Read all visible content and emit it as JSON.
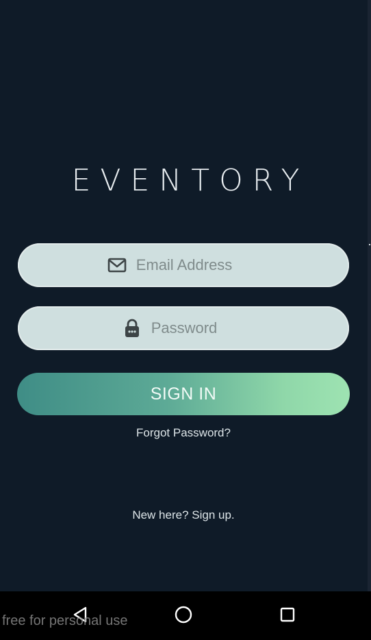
{
  "app": {
    "logo_text": "EVENTORY"
  },
  "form": {
    "email": {
      "placeholder": "Email Address",
      "value": "",
      "icon": "envelope-icon"
    },
    "password": {
      "placeholder": "Password",
      "value": "",
      "icon": "lock-icon"
    },
    "sign_in_label": "SIGN IN",
    "forgot_label": "Forgot Password?",
    "signup_label": "New here? Sign up."
  },
  "navbar": {
    "back_icon": "back-triangle-icon",
    "home_icon": "home-circle-icon",
    "recent_icon": "recent-square-icon"
  },
  "watermark": {
    "text": "free for personal use"
  },
  "colors": {
    "background": "#0f1b28",
    "field_background": "#cfdfdf",
    "button_gradient_start": "#3f8d86",
    "button_gradient_end": "#9ee3b2",
    "navbar": "#000000"
  }
}
